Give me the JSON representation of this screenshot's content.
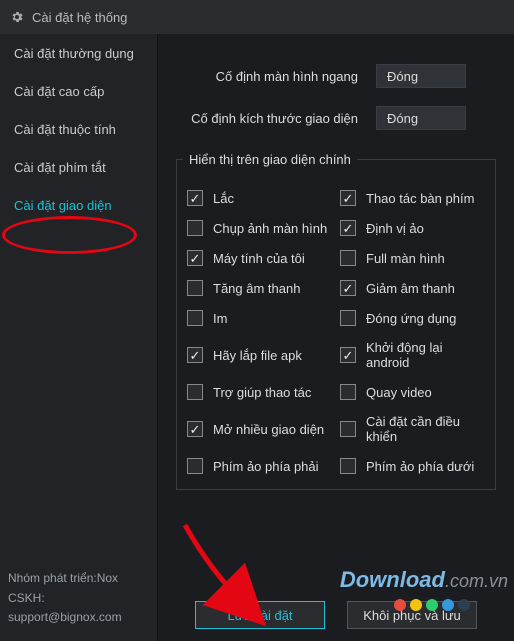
{
  "titlebar": {
    "title": "Cài đặt hệ thống"
  },
  "sidebar": {
    "items": [
      {
        "label": "Cài đặt thường dụng"
      },
      {
        "label": "Cài đặt cao cấp"
      },
      {
        "label": "Cài đặt thuộc tính"
      },
      {
        "label": "Cài đặt phím tắt"
      },
      {
        "label": "Cài đặt giao diện"
      }
    ],
    "footer": {
      "line1": "Nhóm phát triển:Nox",
      "line2": "CSKH:",
      "line3": "support@bignox.com"
    }
  },
  "main": {
    "row1_label": "Cố định màn hình ngang",
    "row1_value": "Đóng",
    "row2_label": "Cố định kích thước giao diện",
    "row2_value": "Đóng",
    "group_legend": "Hiển thị trên giao diện chính",
    "checks": [
      {
        "label": "Lắc",
        "checked": true
      },
      {
        "label": "Thao tác bàn phím",
        "checked": true
      },
      {
        "label": "Chụp ảnh màn hình",
        "checked": false
      },
      {
        "label": "Định vị ảo",
        "checked": true
      },
      {
        "label": "Máy tính của tôi",
        "checked": true
      },
      {
        "label": "Full màn hình",
        "checked": false
      },
      {
        "label": "Tăng âm thanh",
        "checked": false
      },
      {
        "label": "Giảm âm thanh",
        "checked": true
      },
      {
        "label": "Im",
        "checked": false
      },
      {
        "label": "Đóng ứng dụng",
        "checked": false
      },
      {
        "label": "Hãy lắp file apk",
        "checked": true
      },
      {
        "label": "Khởi động lại android",
        "checked": true
      },
      {
        "label": "Trợ giúp thao tác",
        "checked": false
      },
      {
        "label": "Quay video",
        "checked": false
      },
      {
        "label": "Mở nhiều giao diện",
        "checked": true
      },
      {
        "label": "Cài đặt cần điều khiển",
        "checked": false
      },
      {
        "label": "Phím ảo phía phải",
        "checked": false
      },
      {
        "label": "Phím ảo phía dưới",
        "checked": false
      }
    ],
    "save_label": "Lưu cài đặt",
    "restore_label": "Khôi phục và lưu"
  },
  "watermark": {
    "part1": "Download",
    "part2": ".com.vn"
  },
  "dot_colors": [
    "#e74c3c",
    "#f1c40f",
    "#2ecc71",
    "#3498db",
    "#2c3e50"
  ]
}
